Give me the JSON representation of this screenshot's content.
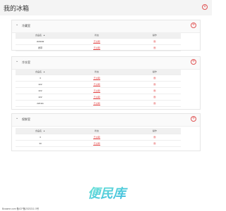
{
  "header": {
    "title": "我的冰箱"
  },
  "panels": [
    {
      "title": "冷藏室",
      "columns": {
        "name": "食品名",
        "status": "状态",
        "action": "操作"
      },
      "rows": [
        {
          "name": "dsfdsfaf",
          "status": "已过期",
          "action": "删"
        },
        {
          "name": "香草",
          "status": "已过期",
          "action": "删"
        }
      ]
    },
    {
      "title": "冷冻室",
      "columns": {
        "name": "食品名",
        "status": "状态",
        "action": "操作"
      },
      "rows": [
        {
          "name": "3",
          "status": "已过期",
          "action": "删"
        },
        {
          "name": "222",
          "status": "已过期",
          "action": "删"
        },
        {
          "name": "222",
          "status": "已过期",
          "action": "删"
        },
        {
          "name": "222",
          "status": "已过期",
          "action": "删"
        },
        {
          "name": "222111",
          "status": "已过期",
          "action": "删"
        }
      ]
    },
    {
      "title": "保鲜室",
      "columns": {
        "name": "食品名",
        "status": "状态",
        "action": "操作"
      },
      "rows": [
        {
          "name": "3",
          "status": "已过期",
          "action": "删"
        },
        {
          "name": "33",
          "status": "已过期",
          "action": "删"
        }
      ]
    }
  ],
  "icons": {
    "collapse": "chevron-down-icon",
    "add": "plus-circle-icon",
    "sort": "sort-up-icon",
    "close": "close-circle-icon"
  },
  "footer": {
    "text": "Bcsame.com 备ICP备2020211 0号"
  },
  "logo": {
    "text": "便民库"
  },
  "colors": {
    "danger": "#e34848",
    "header_bg": "#f4f4f4",
    "logo": "#4fd1c5"
  }
}
